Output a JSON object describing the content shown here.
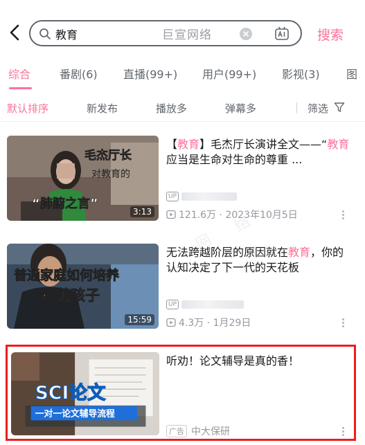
{
  "search": {
    "query": "教育",
    "brand_watermark": "巨宣网络",
    "button_label": "搜索"
  },
  "tabs": [
    {
      "label": "综合"
    },
    {
      "label": "番剧(6)"
    },
    {
      "label": "直播(99+)"
    },
    {
      "label": "用户(99+)"
    },
    {
      "label": "影视(3)"
    },
    {
      "label": "图"
    }
  ],
  "sort": {
    "options": [
      "默认排序",
      "新发布",
      "播放多",
      "弹幕多"
    ],
    "filter_label": "筛选"
  },
  "results": [
    {
      "title_parts": [
        "【",
        "教育",
        "】毛杰厅长演讲全文——“",
        "教育",
        "应当是生命对生命的尊重 ..."
      ],
      "thumb_text": [
        "毛杰厅长",
        "对教育的",
        "“肺腑之言”"
      ],
      "duration": "3:13",
      "up_badge": "UP",
      "views": "121.6万",
      "date": "2023年10月5日"
    },
    {
      "title_parts": [
        "无法跨越阶层的原因就在",
        "教育",
        "，你的认知决定了下一代的天花板"
      ],
      "thumb_text": [
        "普通家庭如何培养",
        "精英孩子"
      ],
      "duration": "15:59",
      "up_badge": "UP",
      "views": "4.3万",
      "date": "1月29日"
    },
    {
      "title": "听劝！论文辅导是真的香！",
      "thumb_text": [
        "SCI论文",
        "一对一论文辅导流程"
      ],
      "ad_tag": "广告",
      "advertiser": "中大保研"
    }
  ],
  "colors": {
    "accent": "#fb7299",
    "text": "#18191c",
    "secondary": "#61666d",
    "meta": "#9499a0",
    "highlight_border": "#ee1c1c"
  },
  "watermark_glyphs": [
    "网",
    "络"
  ]
}
